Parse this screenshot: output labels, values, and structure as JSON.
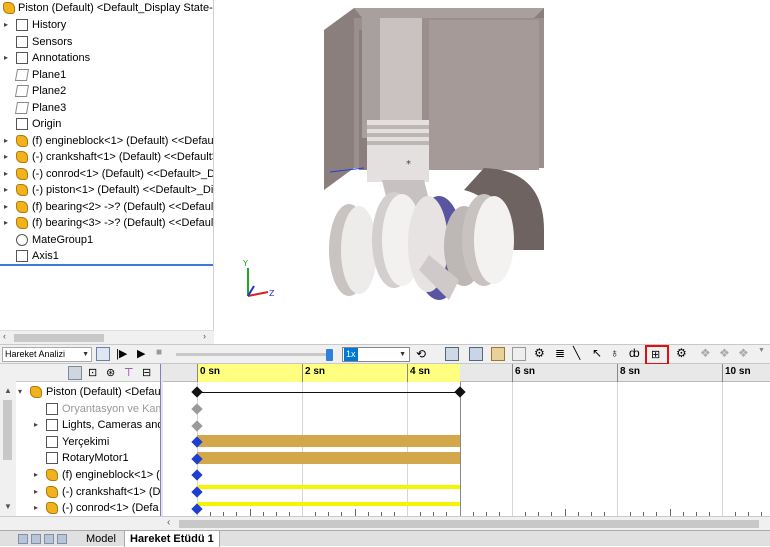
{
  "feature_tree": {
    "root": "Piston (Default) <Default_Display State-1>",
    "items": [
      {
        "label": "History",
        "icon": "history-icon",
        "expand": "▸"
      },
      {
        "label": "Sensors",
        "icon": "sensors-icon",
        "expand": ""
      },
      {
        "label": "Annotations",
        "icon": "annotations-icon",
        "expand": "▸"
      },
      {
        "label": "Plane1",
        "icon": "plane-icon",
        "expand": ""
      },
      {
        "label": "Plane2",
        "icon": "plane-icon",
        "expand": ""
      },
      {
        "label": "Plane3",
        "icon": "plane-icon",
        "expand": ""
      },
      {
        "label": "Origin",
        "icon": "origin-icon",
        "expand": ""
      },
      {
        "label": "(f) engineblock<1> (Default) <<Default",
        "icon": "part-icon",
        "expand": "▸"
      },
      {
        "label": "(-) crankshaft<1> (Default) <<Default>",
        "icon": "part-icon",
        "expand": "▸"
      },
      {
        "label": "(-) conrod<1> (Default) <<Default>_Di",
        "icon": "part-icon",
        "expand": "▸"
      },
      {
        "label": "(-) piston<1> (Default) <<Default>_Dis",
        "icon": "part-icon",
        "expand": "▸"
      },
      {
        "label": "(f) bearing<2> ->? (Default) <<Default",
        "icon": "part-icon",
        "expand": "▸"
      },
      {
        "label": "(f) bearing<3> ->? (Default) <<Default",
        "icon": "part-icon",
        "expand": "▸"
      },
      {
        "label": "MateGroup1",
        "icon": "mategroup-icon",
        "expand": ""
      },
      {
        "label": "Axis1",
        "icon": "axis-icon",
        "expand": ""
      }
    ]
  },
  "toolbar": {
    "study_type": "Hareket Analizi",
    "speed": "1x"
  },
  "motion_tree": {
    "rows": [
      {
        "label": "Piston (Default) <Defaul",
        "icon": "assembly-icon",
        "expand": "▾",
        "muted": false
      },
      {
        "label": "Oryantasyon ve Kam",
        "icon": "orientation-icon",
        "expand": "",
        "muted": true
      },
      {
        "label": "Lights, Cameras and",
        "icon": "lights-icon",
        "expand": "▸",
        "muted": false
      },
      {
        "label": "Yerçekimi",
        "icon": "gravity-icon",
        "expand": "",
        "muted": false
      },
      {
        "label": "RotaryMotor1",
        "icon": "motor-icon",
        "expand": "",
        "muted": false
      },
      {
        "label": "(f) engineblock<1> (",
        "icon": "part-icon",
        "expand": "▸",
        "muted": false
      },
      {
        "label": "(-) crankshaft<1> (De",
        "icon": "part-icon",
        "expand": "▸",
        "muted": false
      },
      {
        "label": "(-) conrod<1> (Defa",
        "icon": "part-icon",
        "expand": "▸",
        "muted": false
      }
    ]
  },
  "timeline": {
    "labels": [
      "0 sn",
      "2 sn",
      "4 sn",
      "6 sn",
      "8 sn",
      "10 sn"
    ],
    "study_end_sec": 5
  },
  "tabs": {
    "model": "Model",
    "motion_study": "Hareket Etüdü 1"
  },
  "colors": {
    "accent": "#3a7bd5",
    "highlight": "#e01010",
    "timeline_yellow": "#ffff80",
    "bar_gold": "#d2a84a",
    "key_blue": "#1e3fd0"
  }
}
